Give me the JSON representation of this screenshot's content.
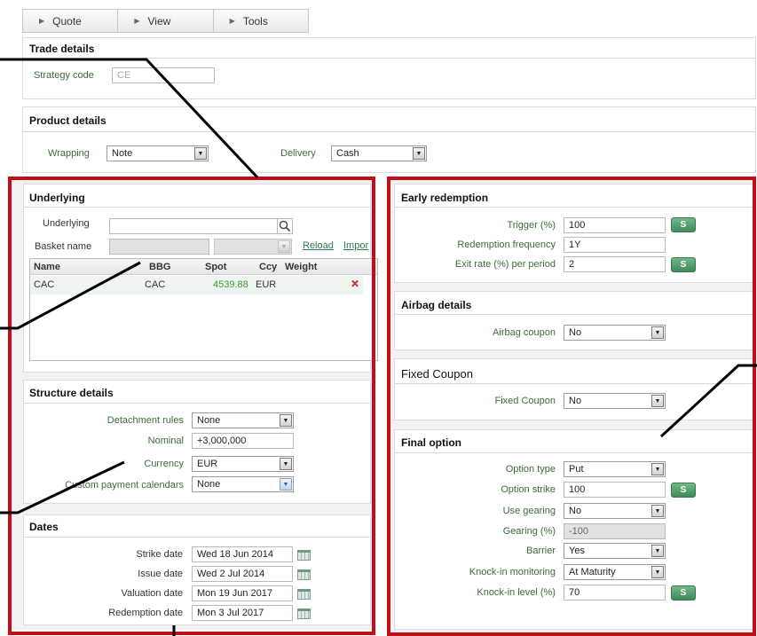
{
  "tabs": [
    {
      "label": "Quote"
    },
    {
      "label": "View"
    },
    {
      "label": "Tools"
    }
  ],
  "trade_details": {
    "title": "Trade details",
    "strategy_code_label": "Strategy code",
    "strategy_code_placeholder": "CE"
  },
  "product_details": {
    "title": "Product details",
    "wrapping_label": "Wrapping",
    "wrapping_value": "Note",
    "delivery_label": "Delivery",
    "delivery_value": "Cash"
  },
  "underlying": {
    "title": "Underlying",
    "underlying_label": "Underlying",
    "basket_label": "Basket name",
    "reload_link": "Reload",
    "import_link": "Impor",
    "columns": [
      "Name",
      "BBG",
      "Spot",
      "Ccy",
      "Weight"
    ],
    "rows": [
      {
        "name": "CAC",
        "bbg": "CAC",
        "spot": "4539.88",
        "ccy": "EUR",
        "weight": ""
      }
    ],
    "remove_glyph": "✕"
  },
  "structure_details": {
    "title": "Structure details",
    "detachment_label": "Detachment rules",
    "detachment_value": "None",
    "nominal_label": "Nominal",
    "nominal_value": "+3,000,000",
    "currency_label": "Currency",
    "currency_value": "EUR",
    "calendars_label": "Custom payment calendars",
    "calendars_value": "None"
  },
  "dates": {
    "title": "Dates",
    "strike_label": "Strike date",
    "strike_value": "Wed 18 Jun 2014",
    "issue_label": "Issue date",
    "issue_value": "Wed 2 Jul 2014",
    "valuation_label": "Valuation date",
    "valuation_value": "Mon 19 Jun 2017",
    "redemption_label": "Redemption date",
    "redemption_value": "Mon 3 Jul 2017"
  },
  "early_redemption": {
    "title": "Early redemption",
    "trigger_label": "Trigger (%)",
    "trigger_value": "100",
    "frequency_label": "Redemption frequency",
    "frequency_value": "1Y",
    "exit_rate_label": "Exit rate (%) per period",
    "exit_rate_value": "2"
  },
  "airbag": {
    "title": "Airbag details",
    "coupon_label": "Airbag coupon",
    "coupon_value": "No"
  },
  "fixed_coupon": {
    "title": "Fixed Coupon",
    "coupon_label": "Fixed Coupon",
    "coupon_value": "No"
  },
  "final_option": {
    "title": "Final option",
    "type_label": "Option type",
    "type_value": "Put",
    "strike_label": "Option strike",
    "strike_value": "100",
    "use_gearing_label": "Use gearing",
    "use_gearing_value": "No",
    "gearing_label": "Gearing (%)",
    "gearing_value": "-100",
    "barrier_label": "Barrier",
    "barrier_value": "Yes",
    "monitoring_label": "Knock-in monitoring",
    "monitoring_value": "At Maturity",
    "level_label": "Knock-in level (%)",
    "level_value": "70"
  },
  "s_button_label": "S",
  "colors": {
    "highlight_border": "#c40d17",
    "spot_value": "#3a9a3a",
    "remove": "#d02020",
    "label_text": "#3c6b3c",
    "s_button": "#4c9466"
  }
}
